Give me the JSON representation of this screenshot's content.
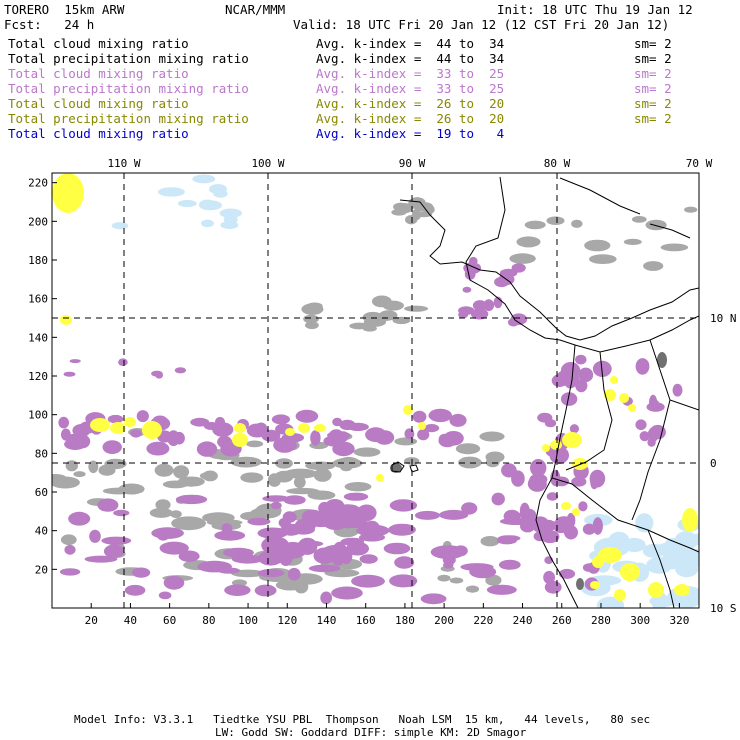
{
  "header": {
    "model": "TORERO  15km ARW",
    "center": "NCAR/MMM",
    "init": "Init: 18 UTC Thu 19 Jan 12",
    "fcst": "Fcst:   24 h",
    "valid": "Valid: 18 UTC Fri 20 Jan 12 (12 CST Fri 20 Jan 12)"
  },
  "legend": [
    {
      "field": "Total cloud mixing ratio",
      "kindex": "Avg. k-index =  44 to  34",
      "sm": "sm= 2",
      "color": "#000000"
    },
    {
      "field": "Total precipitation mixing ratio",
      "kindex": "Avg. k-index =  44 to  34",
      "sm": "sm= 2",
      "color": "#000000"
    },
    {
      "field": "Total cloud mixing ratio",
      "kindex": "Avg. k-index =  33 to  25",
      "sm": "sm= 2",
      "color": "#bb77cc"
    },
    {
      "field": "Total precipitation mixing ratio",
      "kindex": "Avg. k-index =  33 to  25",
      "sm": "sm= 2",
      "color": "#bb77cc"
    },
    {
      "field": "Total cloud mixing ratio",
      "kindex": "Avg. k-index =  26 to  20",
      "sm": "sm= 2",
      "color": "#888800"
    },
    {
      "field": "Total precipitation mixing ratio",
      "kindex": "Avg. k-index =  26 to  20",
      "sm": "sm= 2",
      "color": "#888800"
    },
    {
      "field": "Total cloud mixing ratio",
      "kindex": "Avg. k-index =  19 to   4",
      "sm": "",
      "color": "#0000cc"
    }
  ],
  "footer": {
    "line1": "Model Info: V3.3.1   Tiedtke YSU PBL  Thompson   Noah LSM  15 km,   44 levels,   80 sec",
    "line2": "LW: Godd SW: Goddard DIFF: simple KM: 2D Smagor"
  },
  "chart_data": {
    "type": "heatmap",
    "xlim": [
      0,
      330
    ],
    "ylim": [
      0,
      225
    ],
    "x_ticks": [
      "20",
      "40",
      "60",
      "80",
      "100",
      "120",
      "140",
      "160",
      "180",
      "200",
      "220",
      "240",
      "260",
      "280",
      "300",
      "320"
    ],
    "y_ticks": [
      "20",
      "40",
      "60",
      "80",
      "100",
      "120",
      "140",
      "160",
      "180",
      "200",
      "220"
    ],
    "lon_labels": [
      "110 W",
      "100 W",
      "90 W",
      "80 W",
      "70 W"
    ],
    "lat_labels": [
      "10 N",
      "0",
      "10 S"
    ],
    "colors": {
      "gray": "#a8a8a8",
      "dark_gray": "#707070",
      "purple": "#b87bc4",
      "yellow": "#ffff44",
      "light_blue": "#cce8f8"
    }
  }
}
